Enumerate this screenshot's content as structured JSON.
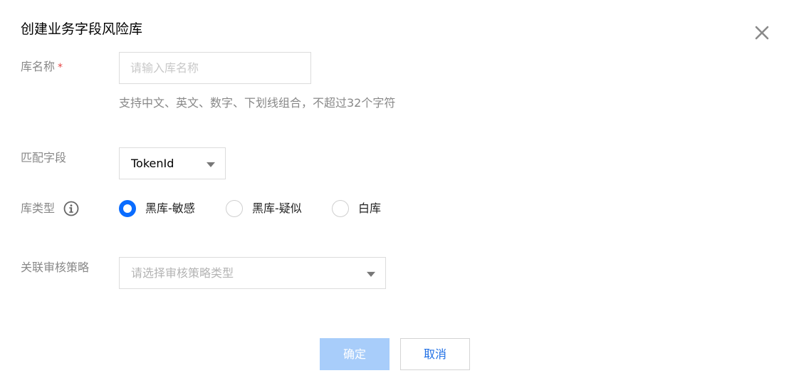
{
  "dialog": {
    "title": "创建业务字段风险库",
    "close_icon": "close-icon"
  },
  "form": {
    "name": {
      "label": "库名称",
      "required_mark": "*",
      "placeholder": "请输入库名称",
      "value": "",
      "hint": "支持中文、英文、数字、下划线组合，不超过32个字符"
    },
    "match_field": {
      "label": "匹配字段",
      "selected": "TokenId"
    },
    "lib_type": {
      "label": "库类型",
      "info_icon": "info-circle-icon",
      "options": [
        {
          "label": "黑库-敏感",
          "checked": true
        },
        {
          "label": "黑库-疑似",
          "checked": false
        },
        {
          "label": "白库",
          "checked": false
        }
      ]
    },
    "policy": {
      "label": "关联审核策略",
      "placeholder": "请选择审核策略类型"
    }
  },
  "buttons": {
    "confirm": "确定",
    "cancel": "取消"
  },
  "colors": {
    "primary": "#0a6cff",
    "primary_disabled": "#a8cdfa",
    "required": "#e54545",
    "label": "#888888",
    "link_text": "#1f6fe5"
  }
}
